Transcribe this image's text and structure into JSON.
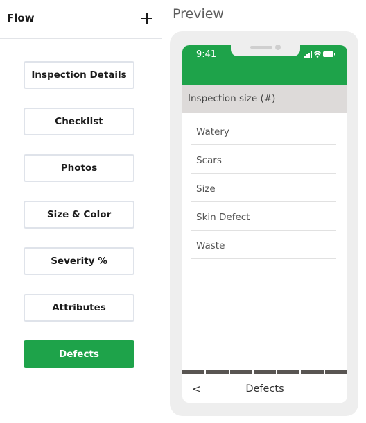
{
  "flow": {
    "title": "Flow",
    "add_label": "+",
    "steps": [
      {
        "label": "Inspection Details",
        "active": false
      },
      {
        "label": "Checklist",
        "active": false
      },
      {
        "label": "Photos",
        "active": false
      },
      {
        "label": "Size & Color",
        "active": false
      },
      {
        "label": "Severity %",
        "active": false
      },
      {
        "label": "Attributes",
        "active": false
      },
      {
        "label": "Defects",
        "active": true
      }
    ]
  },
  "preview": {
    "title": "Preview",
    "status_time": "9:41",
    "list_header": "Inspection size (#)",
    "items": [
      "Watery",
      "Scars",
      "Size",
      "Skin Defect",
      "Waste"
    ],
    "nav_back": "<",
    "nav_title": "Defects"
  },
  "colors": {
    "accent": "#1ea34a",
    "header_bg": "#dddad9",
    "strip": "#595552"
  }
}
